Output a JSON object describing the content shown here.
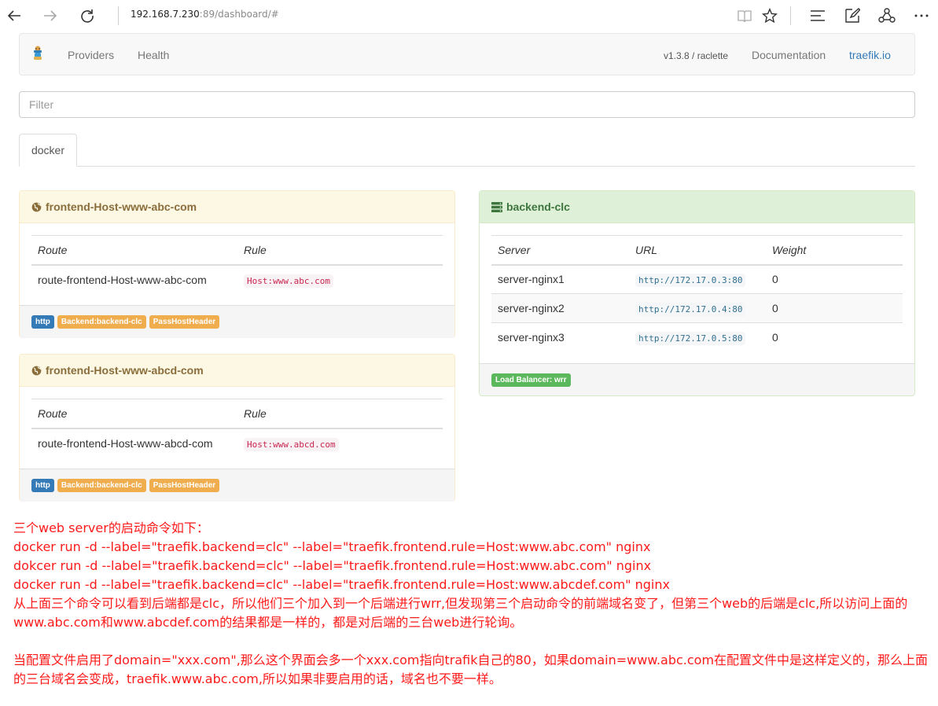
{
  "browser": {
    "url_host": "192.168.7.230",
    "url_rest": ":89/dashboard/#",
    "icons": [
      "back-arrow-icon",
      "forward-arrow-icon",
      "refresh-icon",
      "reading-view-icon",
      "star-icon",
      "hub-icon",
      "web-note-icon",
      "share-icon",
      "more-icon"
    ]
  },
  "navbar": {
    "providers": "Providers",
    "health": "Health",
    "version": "v1.3.8 / raclette",
    "documentation": "Documentation",
    "site": "traefik.io"
  },
  "filter": {
    "placeholder": "Filter"
  },
  "tabs": [
    {
      "label": "docker"
    }
  ],
  "frontends": [
    {
      "title": "frontend-Host-www-abc-com",
      "col_route": "Route",
      "col_rule": "Rule",
      "route": "route-frontend-Host-www-abc-com",
      "rule": "Host:www.abc.com",
      "labels": [
        "http",
        "Backend:backend-clc",
        "PassHostHeader"
      ]
    },
    {
      "title": "frontend-Host-www-abcd-com",
      "col_route": "Route",
      "col_rule": "Rule",
      "route": "route-frontend-Host-www-abcd-com",
      "rule": "Host:www.abcd.com",
      "labels": [
        "http",
        "Backend:backend-clc",
        "PassHostHeader"
      ]
    }
  ],
  "backend": {
    "title": "backend-clc",
    "columns": [
      "Server",
      "URL",
      "Weight"
    ],
    "servers": [
      {
        "name": "server-nginx1",
        "url": "http://172.17.0.3:80",
        "weight": "0"
      },
      {
        "name": "server-nginx2",
        "url": "http://172.17.0.4:80",
        "weight": "0"
      },
      {
        "name": "server-nginx3",
        "url": "http://172.17.0.5:80",
        "weight": "0"
      }
    ],
    "load_balancer": "Load Balancer: wrr"
  },
  "notes": {
    "line1": "三个web server的启动命令如下：",
    "line2": "docker run -d --label=\"traefik.backend=clc\" --label=\"traefik.frontend.rule=Host:www.abc.com\" nginx",
    "line3": "dokcer run -d --label=\"traefik.backend=clc\" --label=\"traefik.frontend.rule=Host:www.abc.com\" nginx",
    "line4": "docker run -d --label=\"traefik.backend=clc\" --label=\"traefik.frontend.rule=Host:www.abcdef.com\" nginx",
    "para1": "从上面三个命令可以看到后端都是clc，所以他们三个加入到一个后端进行wrr,但发现第三个启动命令的前端域名变了，但第三个web的后端是clc,所以访问上面的www.abc.com和www.abcdef.com的结果都是一样的，都是对后端的三台web进行轮询。",
    "para2": "当配置文件启用了domain=\"xxx.com\",那么这个界面会多一个xxx.com指向trafik自己的80，如果domain=www.abc.com在配置文件中是这样定义的，那么上面的三台域名会变成，traefik.www.abc.com,所以如果非要启用的话，域名也不要一样。"
  },
  "colors": {
    "warning_bg": "#fcf8e3",
    "success_bg": "#dff0d8",
    "label_primary": "#337ab7",
    "label_warning": "#f0ad4e",
    "label_success": "#5cb85c",
    "note_red": "#ff1a1a"
  }
}
